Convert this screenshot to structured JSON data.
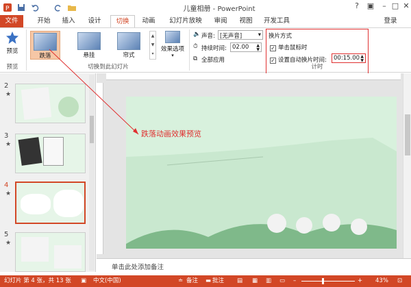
{
  "window": {
    "title": "儿童相册 - PowerPoint",
    "login": "登录"
  },
  "tabs": [
    "文件",
    "开始",
    "插入",
    "设计",
    "切换",
    "动画",
    "幻灯片放映",
    "审阅",
    "视图",
    "开发工具"
  ],
  "ribbon": {
    "preview_label": "预览",
    "preview_group": "预览",
    "effects": [
      "跌落",
      "悬挂",
      "帘式"
    ],
    "effect_options": "效果选项",
    "transition_group": "切换到此幻灯片",
    "sound_label": "声音:",
    "sound_value": "[无声音]",
    "duration_label": "持续时间:",
    "duration_value": "02.00",
    "apply_all": "全部应用",
    "advance_title": "换片方式",
    "on_click": "单击鼠标时",
    "auto_after": "设置自动换片时间:",
    "auto_value": "00:15.00",
    "timing_group": "计时"
  },
  "slides": [
    {
      "num": "2",
      "star": "★"
    },
    {
      "num": "3",
      "star": "★"
    },
    {
      "num": "4",
      "star": "★"
    },
    {
      "num": "5",
      "star": "★"
    }
  ],
  "annotation": "跌落动画效果预览",
  "notes_placeholder": "单击此处添加备注",
  "status": {
    "slide_info": "幻灯片 第 4 张，共 13 张",
    "language": "中文(中国)",
    "notes": "备注",
    "comments": "批注",
    "zoom": "43%"
  },
  "colors": {
    "accent": "#d24726",
    "highlight": "#e03030",
    "slide_bg": "#d8f1dd"
  }
}
